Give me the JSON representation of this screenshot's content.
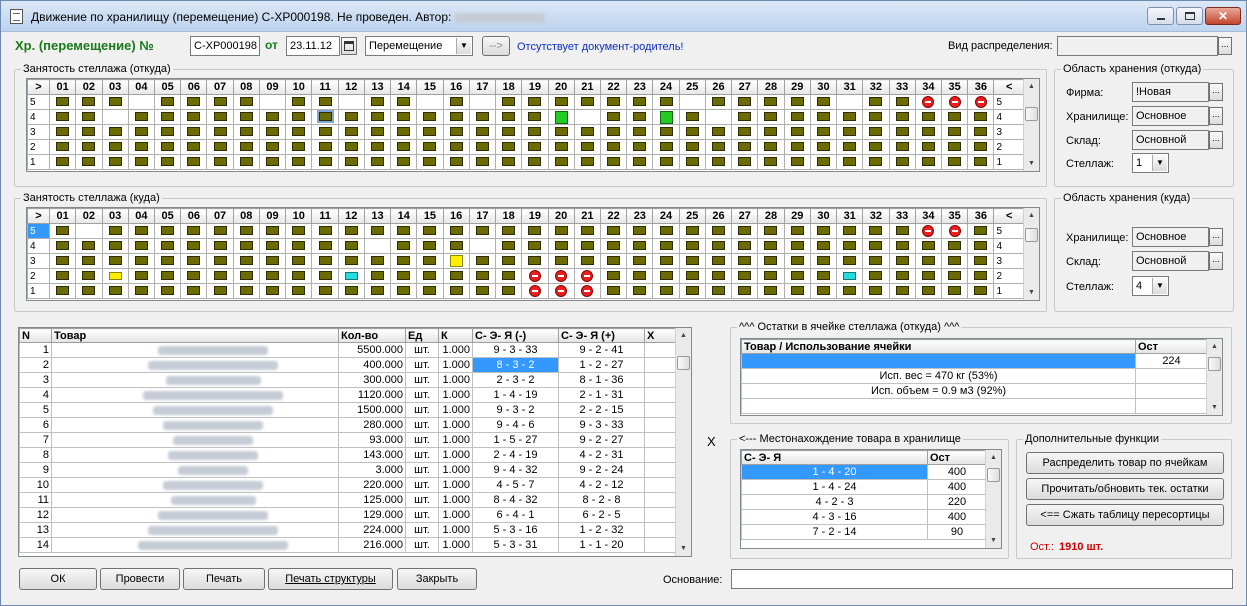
{
  "window": {
    "title": "Движение по хранилищу (перемещение) С-ХР000198. Не проведен. Автор:",
    "author_blurred": true
  },
  "header": {
    "doc_type_label": "Хр. (перемещение) №",
    "doc_number": "С-ХР000198",
    "date_label": "от",
    "date": "23.11.12",
    "operation": "Перемещение",
    "arrow_btn": "-->",
    "parent_msg": "Отсутствует документ-родитель!",
    "distribution_label": "Вид распределения:",
    "distribution_value": ""
  },
  "rack_from": {
    "legend": "Занятость стеллажа (откуда)",
    "col_headers": [
      ">",
      "01",
      "02",
      "03",
      "04",
      "05",
      "06",
      "07",
      "08",
      "09",
      "10",
      "11",
      "12",
      "13",
      "14",
      "15",
      "16",
      "17",
      "18",
      "19",
      "20",
      "21",
      "22",
      "23",
      "24",
      "25",
      "26",
      "27",
      "28",
      "29",
      "30",
      "31",
      "32",
      "33",
      "34",
      "35",
      "36",
      "<"
    ],
    "row_labels": [
      "5",
      "4",
      "3",
      "2",
      "1"
    ]
  },
  "rack_to": {
    "legend": "Занятость стеллажа (куда)",
    "row_labels": [
      "5",
      "4",
      "3",
      "2",
      "1"
    ]
  },
  "area_from": {
    "legend": "Область хранения (откуда)",
    "firm_label": "Фирма:",
    "firm": "!Новая",
    "storage_label": "Хранилище:",
    "storage": "Основное",
    "warehouse_label": "Склад:",
    "warehouse": "Основной",
    "rack_label": "Стеллаж:",
    "rack": "1"
  },
  "area_to": {
    "legend": "Область хранения (куда)",
    "storage_label": "Хранилище:",
    "storage": "Основное",
    "warehouse_label": "Склад:",
    "warehouse": "Основной",
    "rack_label": "Стеллаж:",
    "rack": "4"
  },
  "goods": {
    "headers": [
      "N",
      "Товар",
      "Кол-во",
      "Ед",
      "К",
      "С- Э- Я (-)",
      "С- Э- Я (+)",
      "Х"
    ],
    "rows": [
      {
        "n": "1",
        "qty": "5500.000",
        "unit": "шт.",
        "k": "1.000",
        "from": "9 - 3 - 33",
        "to": "9 - 2 - 41"
      },
      {
        "n": "2",
        "qty": "400.000",
        "unit": "шт.",
        "k": "1.000",
        "from": "8 - 3 - 2",
        "to": "1 - 2 - 27",
        "selected": true
      },
      {
        "n": "3",
        "qty": "300.000",
        "unit": "шт.",
        "k": "1.000",
        "from": "2 - 3 - 2",
        "to": "8 - 1 - 36"
      },
      {
        "n": "4",
        "qty": "1120.000",
        "unit": "шт.",
        "k": "1.000",
        "from": "1 - 4 - 19",
        "to": "2 - 1 - 31"
      },
      {
        "n": "5",
        "qty": "1500.000",
        "unit": "шт.",
        "k": "1.000",
        "from": "9 - 3 - 2",
        "to": "2 - 2 - 15"
      },
      {
        "n": "6",
        "qty": "280.000",
        "unit": "шт.",
        "k": "1.000",
        "from": "9 - 4 - 6",
        "to": "9 - 3 - 33"
      },
      {
        "n": "7",
        "qty": "93.000",
        "unit": "шт.",
        "k": "1.000",
        "from": "1 - 5 - 27",
        "to": "9 - 2 - 27"
      },
      {
        "n": "8",
        "qty": "143.000",
        "unit": "шт.",
        "k": "1.000",
        "from": "2 - 4 - 19",
        "to": "4 - 2 - 31"
      },
      {
        "n": "9",
        "qty": "3.000",
        "unit": "шт.",
        "k": "1.000",
        "from": "9 - 4 - 32",
        "to": "9 - 2 - 24"
      },
      {
        "n": "10",
        "qty": "220.000",
        "unit": "шт.",
        "k": "1.000",
        "from": "4 - 5 - 7",
        "to": "4 - 2 - 12"
      },
      {
        "n": "11",
        "qty": "125.000",
        "unit": "шт.",
        "k": "1.000",
        "from": "8 - 4 - 32",
        "to": "8 - 2 - 8"
      },
      {
        "n": "12",
        "qty": "129.000",
        "unit": "шт.",
        "k": "1.000",
        "from": "6 - 4 - 1",
        "to": "6 - 2 - 5"
      },
      {
        "n": "13",
        "qty": "224.000",
        "unit": "шт.",
        "k": "1.000",
        "from": "5 - 3 - 16",
        "to": "1 - 2 - 32"
      },
      {
        "n": "14",
        "qty": "216.000",
        "unit": "шт.",
        "k": "1.000",
        "from": "5 - 3 - 31",
        "to": "1 - 1 - 20"
      }
    ]
  },
  "cell_rest": {
    "legend": "^^^ Остатки в ячейке стеллажа (откуда) ^^^",
    "h1": "Товар / Использование ячейки",
    "h2": "Ост",
    "rows": [
      {
        "a": "",
        "b": "224",
        "sel": true
      },
      {
        "a": "Исп. вес = 470 кг (53%)",
        "b": ""
      },
      {
        "a": "Исп. объем = 0.9 м3 (92%)",
        "b": ""
      }
    ]
  },
  "location": {
    "legend": "<--- Местонахождение товара в хранилище",
    "h1": "С- Э- Я",
    "h2": "Ост",
    "rows": [
      {
        "a": "1 - 4 - 20",
        "b": "400",
        "sel": true
      },
      {
        "a": "1 - 4 - 24",
        "b": "400"
      },
      {
        "a": "4 - 2 - 3",
        "b": "220"
      },
      {
        "a": "4 - 3 - 16",
        "b": "400"
      },
      {
        "a": "7 - 2 - 14",
        "b": "90"
      }
    ]
  },
  "extra": {
    "legend": "Дополнительные функции",
    "b1": "Распределить товар по ячейкам",
    "b2": "Прочитать/обновить тек. остатки",
    "b3": "<==   Сжать таблицу пересортицы",
    "ost_label": "Ост.:",
    "ost_value": "1910 шт."
  },
  "close_x": "X",
  "footer": {
    "ok": "ОК",
    "post": "Провести",
    "print": "Печать",
    "print_struct": "Печать структуры",
    "close": "Закрыть",
    "basis_label": "Основание:",
    "basis": ""
  }
}
